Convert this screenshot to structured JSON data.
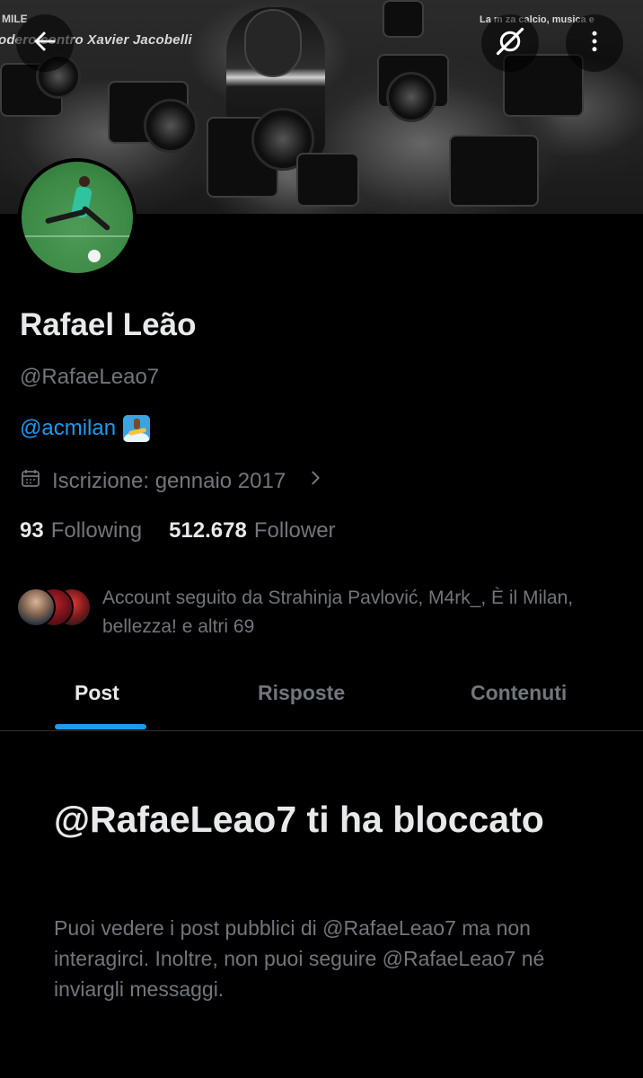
{
  "banner": {
    "text_topleft": "MILE",
    "text_left": "odero    contro Xavier Jacobelli",
    "text_right": "La m     za calcio, musica e"
  },
  "header": {
    "back_icon": "arrow-left-icon",
    "grok_icon": "grok-icon",
    "more_icon": "more-vertical-icon"
  },
  "profile": {
    "name": "Rafael Leão",
    "handle": "@RafaeLeao7",
    "bio_link": "@acmilan",
    "bio_emoji": "person-surfing-emoji",
    "joined": "Iscrizione: gennaio 2017",
    "following_count": "93",
    "following_label": "Following",
    "followers_count": "512.678",
    "followers_label": "Follower",
    "followed_by": "Account seguito da Strahinja Pavlović, M4rk_, È il Milan, bellezza! e altri 69"
  },
  "tabs": [
    {
      "label": "Post",
      "active": true
    },
    {
      "label": "Risposte",
      "active": false
    },
    {
      "label": "Contenuti",
      "active": false
    }
  ],
  "blocked": {
    "title": "@RafaeLeao7 ti ha bloccato",
    "description": "Puoi vedere i post pubblici di @RafaeLeao7 ma non interagirci. Inoltre, non puoi seguire @RafaeLeao7 né inviargli messaggi."
  },
  "colors": {
    "accent": "#1d9bf0",
    "text": "#e7e9ea",
    "muted": "#71767b",
    "background": "#000000"
  }
}
